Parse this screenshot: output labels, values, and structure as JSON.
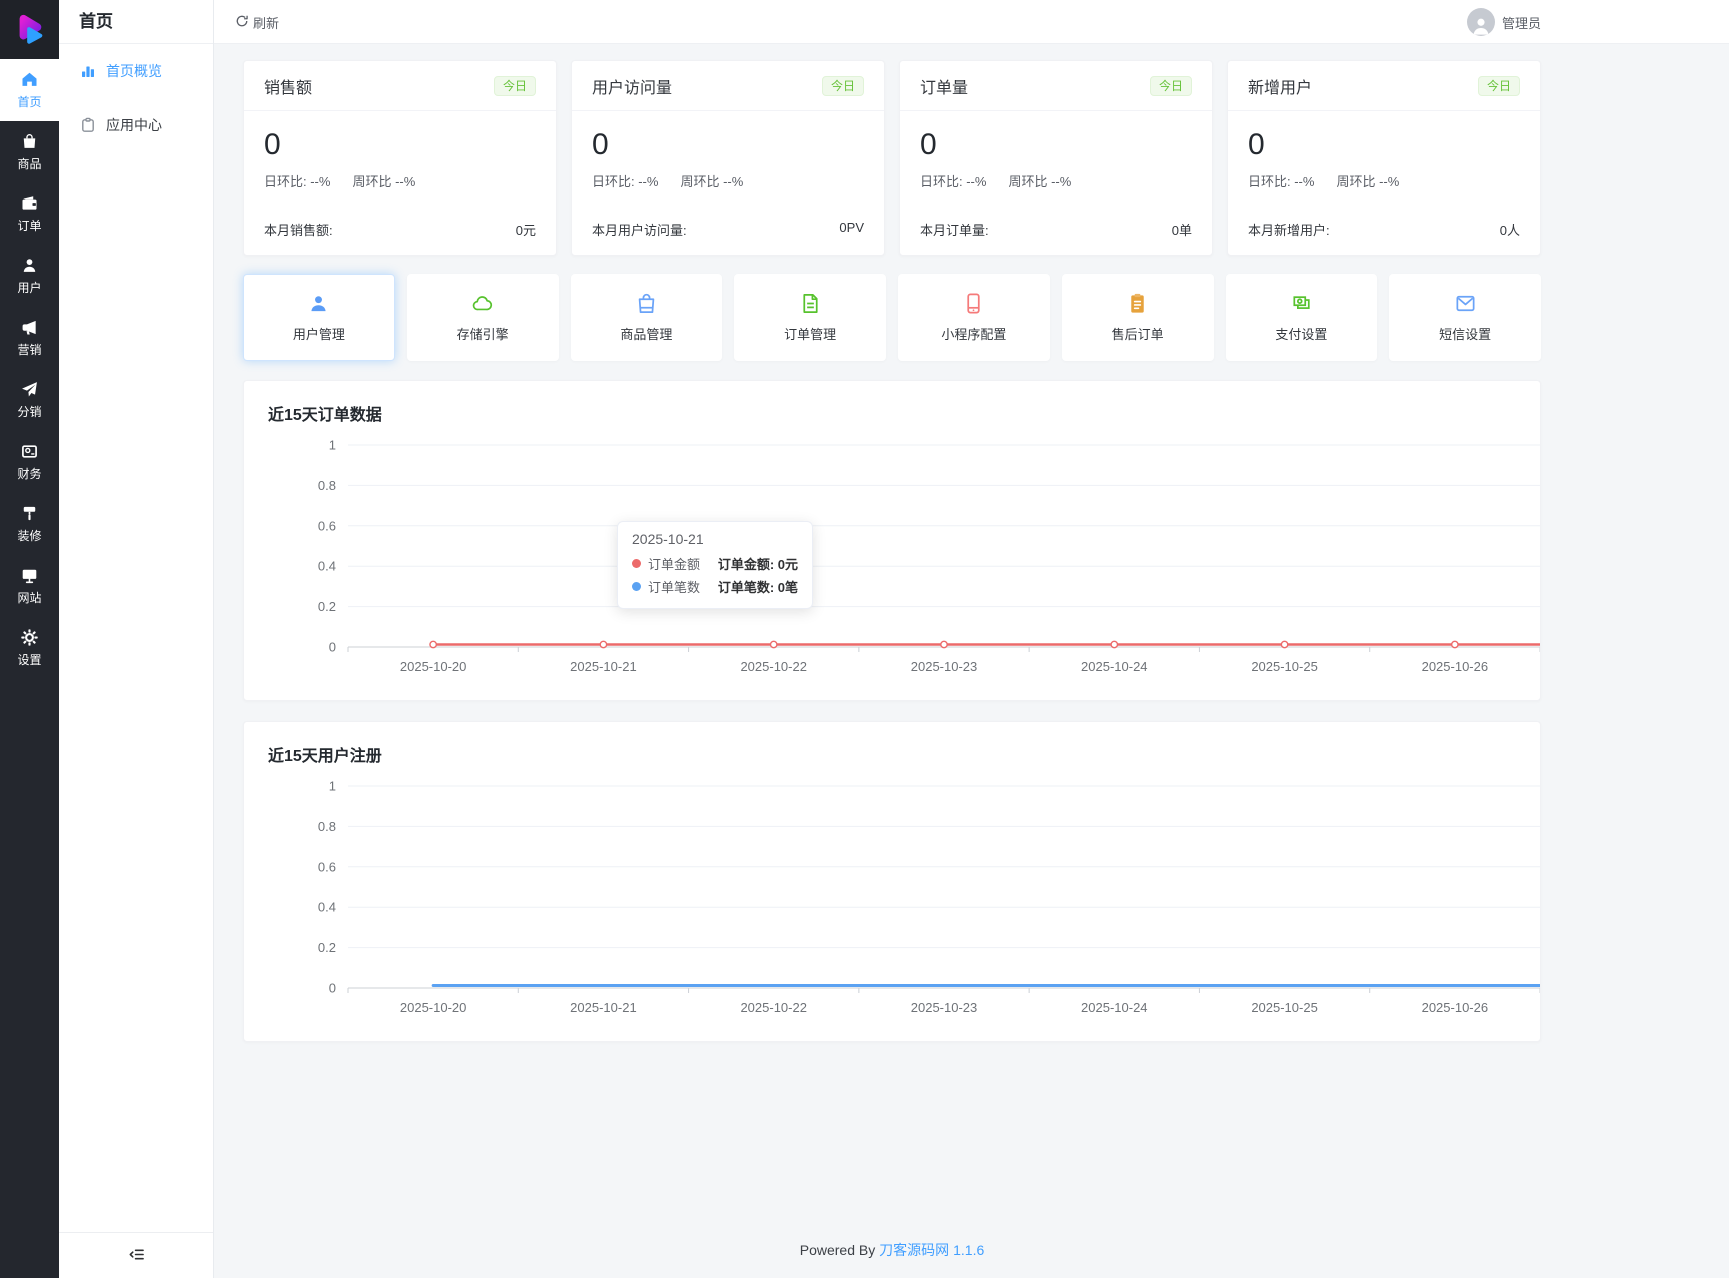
{
  "colors": {
    "accent": "#409eff",
    "success": "#67c23a",
    "warning": "#e6a23c",
    "danger": "#f56c6c",
    "chart_red": "#ec6a6a",
    "chart_blue": "#5ba2f2",
    "sidebar_bg": "#24272e"
  },
  "header": {
    "refresh_label": "刷新",
    "user_name": "管理员"
  },
  "sidebar": {
    "items": [
      {
        "label": "首页",
        "active": true
      },
      {
        "label": "商品"
      },
      {
        "label": "订单"
      },
      {
        "label": "用户"
      },
      {
        "label": "营销"
      },
      {
        "label": "分销"
      },
      {
        "label": "财务"
      },
      {
        "label": "装修"
      },
      {
        "label": "网站"
      },
      {
        "label": "设置"
      }
    ]
  },
  "submenu": {
    "title": "首页",
    "items": [
      {
        "label": "首页概览",
        "active": true
      },
      {
        "label": "应用中心"
      }
    ]
  },
  "stat_cards": [
    {
      "title": "销售额",
      "badge": "今日",
      "value": "0",
      "day": "日环比: --%",
      "week": "周环比 --%",
      "foot_label": "本月销售额:",
      "foot_value": "0元"
    },
    {
      "title": "用户访问量",
      "badge": "今日",
      "value": "0",
      "day": "日环比: --%",
      "week": "周环比 --%",
      "foot_label": "本月用户访问量:",
      "foot_value": "0PV"
    },
    {
      "title": "订单量",
      "badge": "今日",
      "value": "0",
      "day": "日环比: --%",
      "week": "周环比 --%",
      "foot_label": "本月订单量:",
      "foot_value": "0单"
    },
    {
      "title": "新增用户",
      "badge": "今日",
      "value": "0",
      "day": "日环比: --%",
      "week": "周环比 --%",
      "foot_label": "本月新增用户:",
      "foot_value": "0人"
    }
  ],
  "shortcuts": [
    {
      "label": "用户管理",
      "icon": "user-icon"
    },
    {
      "label": "存储引擎",
      "icon": "cloud-icon"
    },
    {
      "label": "商品管理",
      "icon": "shopping-bag-icon"
    },
    {
      "label": "订单管理",
      "icon": "document-icon"
    },
    {
      "label": "小程序配置",
      "icon": "smartphone-icon"
    },
    {
      "label": "售后订单",
      "icon": "clipboard-icon"
    },
    {
      "label": "支付设置",
      "icon": "money-icon"
    },
    {
      "label": "短信设置",
      "icon": "envelope-icon"
    }
  ],
  "chart_data": [
    {
      "type": "line",
      "title": "近15天订单数据",
      "x": [
        "2025-10-20",
        "2025-10-21",
        "2025-10-22",
        "2025-10-23",
        "2025-10-24",
        "2025-10-25",
        "2025-10-26"
      ],
      "series": [
        {
          "name": "订单笔数",
          "color": "#5ba2f2",
          "values": [
            0,
            0,
            0,
            0,
            0,
            0,
            0
          ],
          "hidden": true
        },
        {
          "name": "订单金额",
          "color": "#ec6a6a",
          "values": [
            0,
            0,
            0,
            0,
            0,
            0,
            0
          ],
          "markers": true,
          "width": 2.5
        }
      ],
      "ylim": [
        0,
        1
      ],
      "yticks": [
        0,
        0.2,
        0.4,
        0.6,
        0.8,
        1
      ],
      "grid": true,
      "legend_position": "none",
      "tooltip": {
        "title": "2025-10-21",
        "rows": [
          {
            "name": "订单金额",
            "value": "订单金额: 0元",
            "dot_color": "#ec6a6a"
          },
          {
            "name": "订单笔数",
            "value": "订单笔数: 0笔",
            "dot_color": "#5ba2f2"
          }
        ]
      }
    },
    {
      "type": "line",
      "title": "近15天用户注册",
      "x": [
        "2025-10-20",
        "2025-10-21",
        "2025-10-22",
        "2025-10-23",
        "2025-10-24",
        "2025-10-25",
        "2025-10-26"
      ],
      "series": [
        {
          "name": "用户注册",
          "color": "#5ba2f2",
          "values": [
            0,
            0,
            0,
            0,
            0,
            0,
            0
          ],
          "markers": false,
          "width": 3
        }
      ],
      "ylim": [
        0,
        1
      ],
      "yticks": [
        0,
        0.2,
        0.4,
        0.6,
        0.8,
        1
      ],
      "grid": true,
      "legend_position": "none"
    }
  ],
  "footer": {
    "prefix": "Powered By ",
    "link": "刀客源码网",
    "version": "1.1.6"
  }
}
